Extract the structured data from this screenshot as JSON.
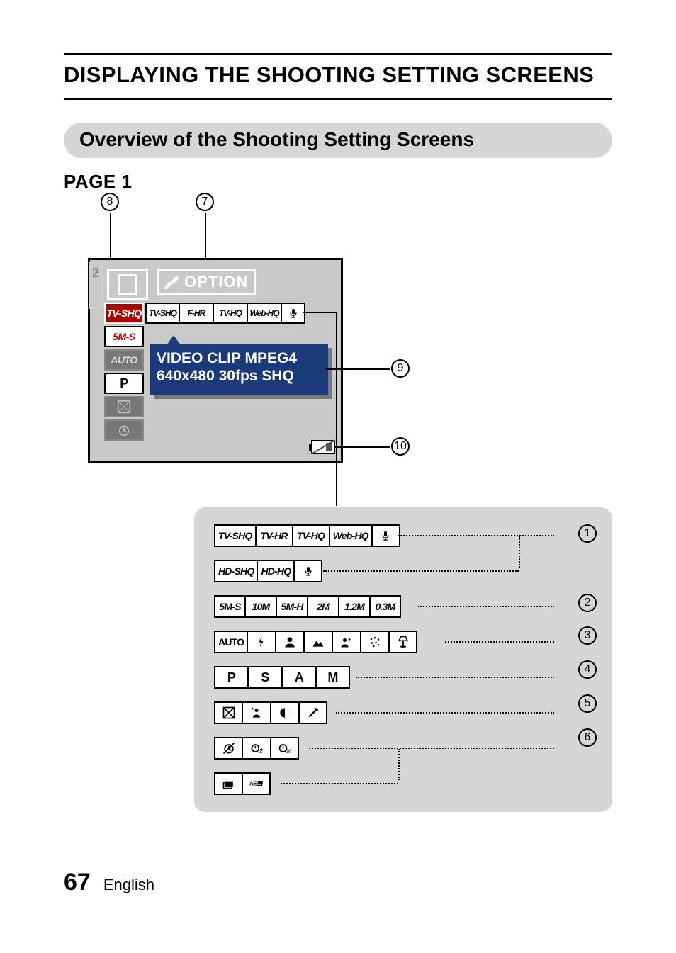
{
  "header": {
    "title": "DISPLAYING THE SHOOTING SETTING SCREENS",
    "subtitle": "Overview of the Shooting Setting Screens",
    "page_label": "PAGE 1"
  },
  "footer": {
    "page_number": "67",
    "language": "English"
  },
  "callouts": {
    "c1": "1",
    "c2": "2",
    "c3": "3",
    "c4": "4",
    "c5": "5",
    "c6": "6",
    "c7": "7",
    "c8": "8",
    "c9": "9",
    "c10": "10"
  },
  "screen": {
    "tab2_label": "2",
    "option_label": "OPTION",
    "top_row": [
      "TV-SHQ",
      "F-HR",
      "TV-HQ",
      "Web-HQ"
    ],
    "left_col": [
      "TV-SHQ",
      "5M-S",
      "AUTO",
      "P"
    ],
    "tooltip_line1": "VIDEO CLIP MPEG4",
    "tooltip_line2": "640x480 30fps SHQ"
  },
  "panel": {
    "row1a": [
      "TV-SHQ",
      "TV-HR",
      "TV-HQ",
      "Web-HQ"
    ],
    "row1b": [
      "HD-SHQ",
      "HD-HQ"
    ],
    "row2": [
      "5M-S",
      "10M",
      "5M-H",
      "2M",
      "1.2M",
      "0.3M"
    ],
    "row3": [
      "AUTO"
    ],
    "row4": [
      "P",
      "S",
      "A",
      "M"
    ]
  }
}
